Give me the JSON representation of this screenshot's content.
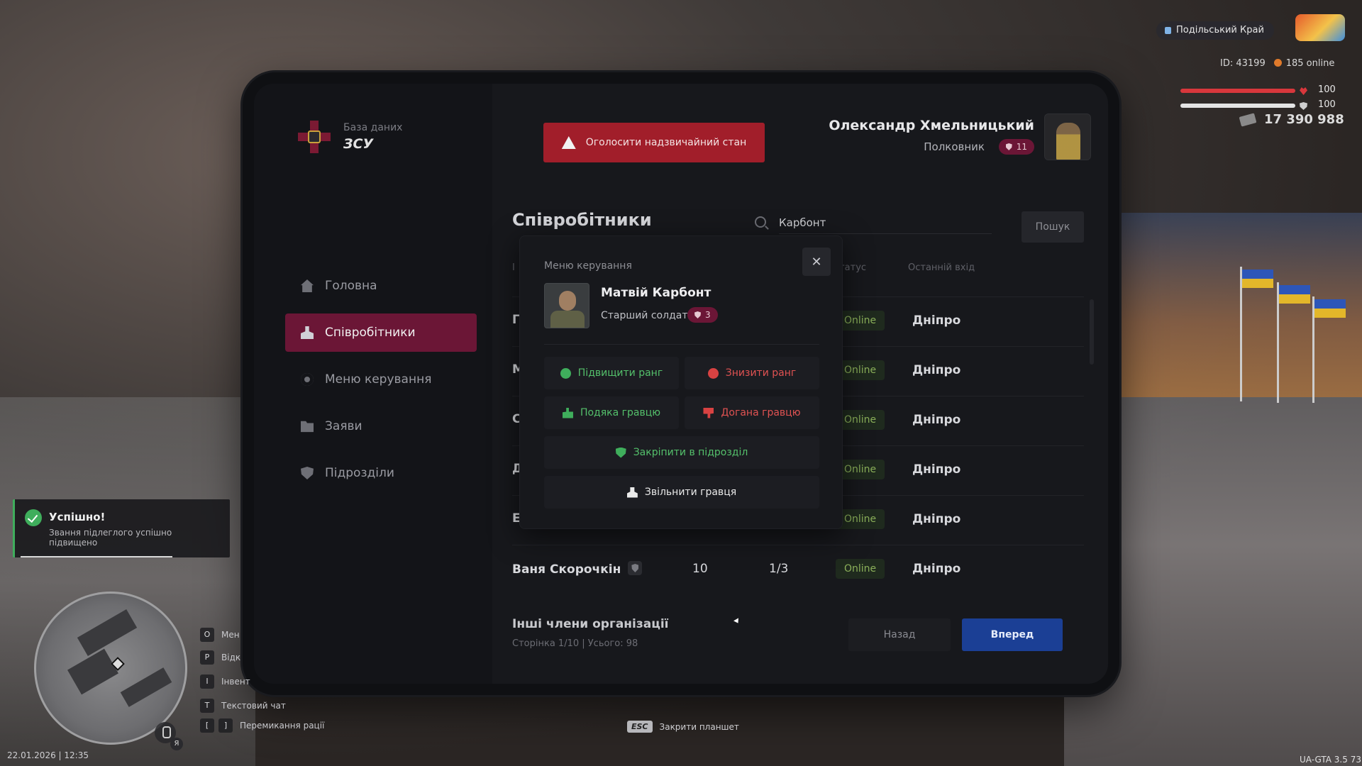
{
  "hud": {
    "server_name": "Подільський Край",
    "player_id": "ID: 43199",
    "online": "185 online",
    "health": "100",
    "armor": "100",
    "money": "17 390 988"
  },
  "tablet": {
    "logo": {
      "subtitle": "База даних",
      "title": "ЗСУ"
    },
    "nav": [
      {
        "label": "Головна",
        "icon": "home-icon"
      },
      {
        "label": "Співробітники",
        "icon": "users-icon"
      },
      {
        "label": "Меню керування",
        "icon": "gear-icon"
      },
      {
        "label": "Заяви",
        "icon": "folder-icon"
      },
      {
        "label": "Підрозділи",
        "icon": "shield-icon"
      }
    ],
    "emergency_button": "Оголосити надзвичайний стан",
    "user": {
      "name": "Олександр Хмельницький",
      "rank": "Полковник",
      "rank_level": "11"
    },
    "page_title": "Співробітники",
    "search": {
      "value": "Карбонт",
      "button": "Пошук"
    },
    "table": {
      "headers": {
        "first": "І",
        "status": "Статус",
        "last_login": "Останній вхід"
      },
      "rows": [
        {
          "name": "Г",
          "level": "",
          "warns": "",
          "status": "Online",
          "city": "Дніпро"
        },
        {
          "name": "М",
          "level": "",
          "warns": "",
          "status": "Online",
          "city": "Дніпро"
        },
        {
          "name": "С",
          "level": "",
          "warns": "",
          "status": "Online",
          "city": "Дніпро"
        },
        {
          "name": "Д",
          "level": "",
          "warns": "",
          "status": "Online",
          "city": "Дніпро"
        },
        {
          "name": "Е",
          "level": "",
          "warns": "",
          "status": "Online",
          "city": "Дніпро"
        },
        {
          "name": "Ваня Скорочкін",
          "level": "10",
          "warns": "1/3",
          "status": "Online",
          "city": "Дніпро"
        }
      ]
    },
    "others": {
      "title": "Інші члени організації",
      "subtitle": "Сторінка 1/10 | Усього: 98"
    },
    "pagination": {
      "back": "Назад",
      "next": "Вперед"
    }
  },
  "modal": {
    "label": "Меню керування",
    "close": "✕",
    "player": {
      "name": "Матвій Карбонт",
      "rank": "Старший солдат",
      "rank_level": "3"
    },
    "actions": {
      "promote": "Підвищити ранг",
      "demote": "Знизити ранг",
      "thank": "Подяка гравцю",
      "reprimand": "Догана гравцю",
      "assign_unit": "Закріпити в підрозділ",
      "dismiss": "Звільнити гравця"
    }
  },
  "notification": {
    "title": "Успішно!",
    "message": "Звання підлеглого успішно підвищено"
  },
  "hotkeys": [
    {
      "keys": [
        "O"
      ],
      "label": "Мен"
    },
    {
      "keys": [
        "P"
      ],
      "label": "Відк"
    },
    {
      "keys": [
        "I"
      ],
      "label": "Інвент"
    },
    {
      "keys": [
        "T"
      ],
      "label": "Текстовий чат"
    },
    {
      "keys": [
        "[",
        "]"
      ],
      "label": "Перемикання рації"
    }
  ],
  "footer": {
    "datetime": "22.01.2026 | 12:35",
    "version": "UA-GTA 3.5  73",
    "esc_key": "ESC",
    "esc_label": "Закрити планшет",
    "lang": "Я"
  },
  "colors": {
    "accent": "#6b1636",
    "danger": "#a11e2a",
    "primary": "#1b3f95",
    "online": "#8bb05a",
    "success": "#3fae5c"
  }
}
